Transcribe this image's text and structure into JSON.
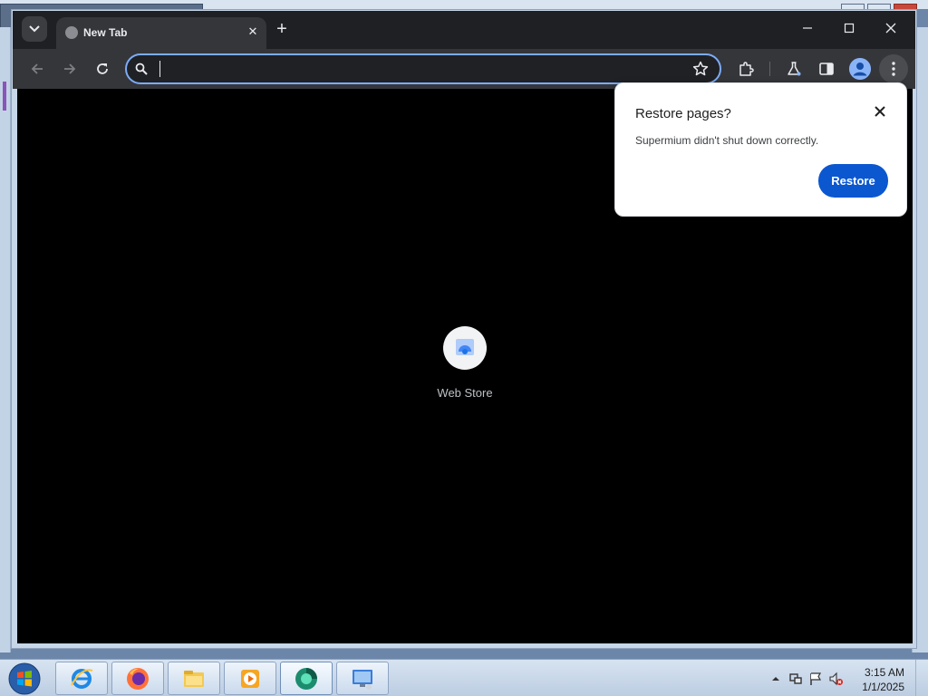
{
  "browser": {
    "tab": {
      "title": "New Tab"
    },
    "omnibox": {
      "value": "",
      "placeholder": ""
    },
    "new_tab_page": {
      "shortcuts": [
        {
          "label": "Web Store"
        }
      ]
    },
    "restore_bubble": {
      "title": "Restore pages?",
      "message": "Supermium didn't shut down correctly.",
      "restore_label": "Restore"
    },
    "theme": {
      "frame": "#1f2023",
      "toolbar": "#35363a",
      "accent": "#0b57d0",
      "focus_ring": "#7cacf8"
    }
  },
  "taskbar": {
    "pinned": [
      {
        "name": "internet-explorer-icon"
      },
      {
        "name": "firefox-icon"
      },
      {
        "name": "file-explorer-icon"
      },
      {
        "name": "media-player-icon"
      },
      {
        "name": "supermium-icon"
      },
      {
        "name": "remote-desktop-icon"
      }
    ],
    "clock": {
      "time": "3:15 AM",
      "date": "1/1/2025"
    }
  }
}
